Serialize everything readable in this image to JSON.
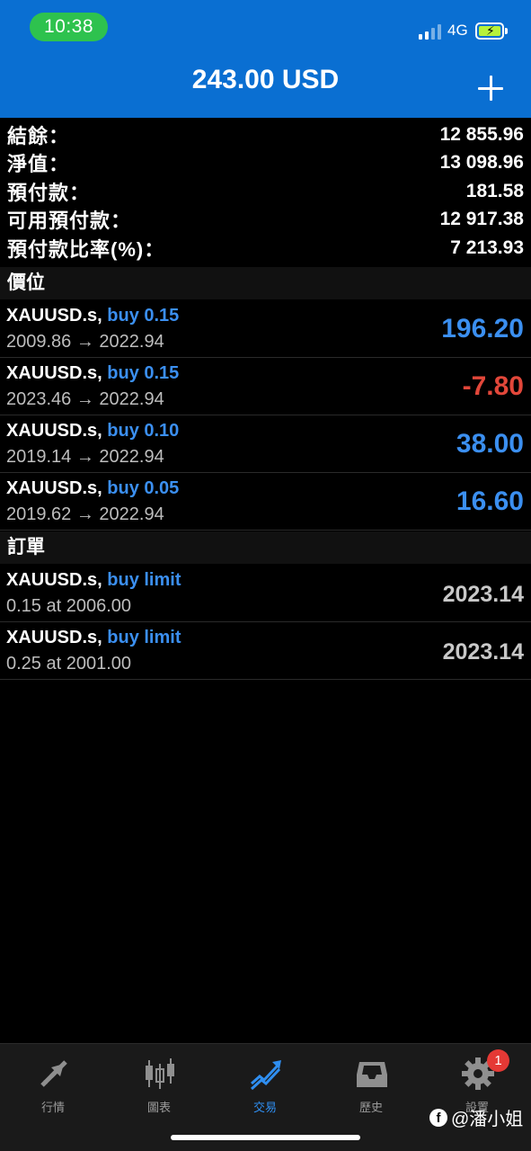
{
  "status_bar": {
    "time": "10:38",
    "network": "4G"
  },
  "header": {
    "title": "243.00 USD",
    "add_button": "+"
  },
  "summary": [
    {
      "label": "結餘：",
      "value": "12 855.96"
    },
    {
      "label": "淨值：",
      "value": "13 098.96"
    },
    {
      "label": "預付款：",
      "value": "181.58"
    },
    {
      "label": "可用預付款：",
      "value": "12 917.38"
    },
    {
      "label": "預付款比率(%)：",
      "value": "7 213.93"
    }
  ],
  "positions": {
    "header": "價位",
    "items": [
      {
        "symbol": "XAUUSD.s,",
        "side": "buy 0.15",
        "prices": "2009.86 → 2022.94",
        "profit": "196.20",
        "profit_color": "#3b8ff0"
      },
      {
        "symbol": "XAUUSD.s,",
        "side": "buy 0.15",
        "prices": "2023.46 → 2022.94",
        "profit": "-7.80",
        "profit_color": "#e2473a"
      },
      {
        "symbol": "XAUUSD.s,",
        "side": "buy 0.10",
        "prices": "2019.14 → 2022.94",
        "profit": "38.00",
        "profit_color": "#3b8ff0"
      },
      {
        "symbol": "XAUUSD.s,",
        "side": "buy 0.05",
        "prices": "2019.62 → 2022.94",
        "profit": "16.60",
        "profit_color": "#3b8ff0"
      }
    ]
  },
  "orders": {
    "header": "訂單",
    "items": [
      {
        "symbol": "XAUUSD.s,",
        "side": "buy limit",
        "detail": "0.15 at 2006.00",
        "price": "2023.14"
      },
      {
        "symbol": "XAUUSD.s,",
        "side": "buy limit",
        "detail": "0.25 at 2001.00",
        "price": "2023.14"
      }
    ]
  },
  "tabbar": {
    "tabs": [
      {
        "label": "行情",
        "icon": "quotes-arrows-icon",
        "active": false
      },
      {
        "label": "圖表",
        "icon": "candlestick-chart-icon",
        "active": false
      },
      {
        "label": "交易",
        "icon": "trade-trend-icon",
        "active": true
      },
      {
        "label": "歷史",
        "icon": "history-inbox-icon",
        "active": false
      },
      {
        "label": "設置",
        "icon": "settings-gear-icon",
        "active": false
      }
    ],
    "settings_badge": "1"
  },
  "watermark": "@潘小姐",
  "colors": {
    "header_blue": "#0a6fd2",
    "profit_blue": "#3b8ff0",
    "loss_red": "#e2473a",
    "active_tab": "#2f8ef0"
  }
}
